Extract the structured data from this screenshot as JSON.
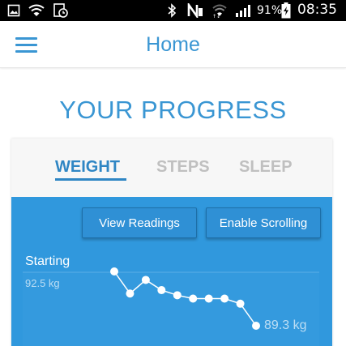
{
  "status_bar": {
    "battery_percent": "91%",
    "time": "08:35",
    "icons": [
      "image-icon",
      "wifi-icon",
      "clock-notification-icon",
      "bluetooth-icon",
      "nfc-icon",
      "wifi-signal-icon",
      "cell-signal-icon",
      "battery-charging-icon"
    ]
  },
  "app_bar": {
    "title": "Home",
    "menu_icon": "hamburger-menu-icon"
  },
  "page": {
    "heading": "YOUR PROGRESS"
  },
  "tabs": [
    {
      "label": "WEIGHT",
      "active": true
    },
    {
      "label": "STEPS",
      "active": false
    },
    {
      "label": "SLEEP",
      "active": false
    }
  ],
  "buttons": {
    "view_readings": "View Readings",
    "enable_scrolling": "Enable Scrolling"
  },
  "colors": {
    "accent": "#3a96d3",
    "panel": "#3098dd",
    "tab_inactive": "#c0c0c0"
  },
  "chart_data": {
    "type": "line",
    "start_label": "Starting",
    "start_value_label": "92.5 kg",
    "end_value_label": "89.3 kg",
    "unit": "kg",
    "y_range": [
      89.3,
      92.5
    ],
    "series": [
      {
        "values": [
          92.5,
          91.2,
          92.0,
          91.4,
          91.1,
          90.9,
          90.9,
          90.9,
          90.6,
          89.3
        ]
      }
    ]
  }
}
